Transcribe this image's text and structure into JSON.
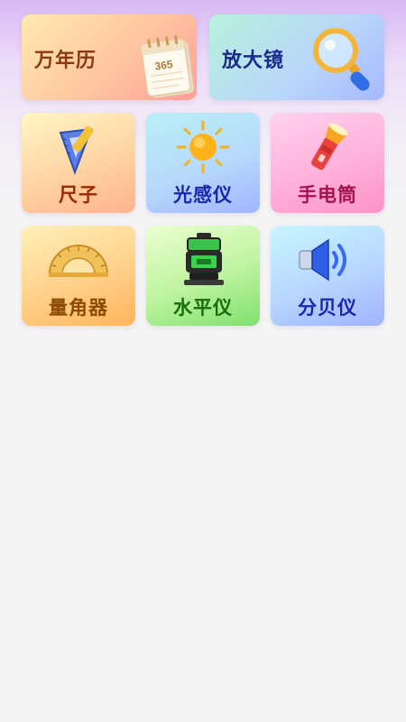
{
  "tools": {
    "calendar": {
      "label": "万年历",
      "icon": "calendar-icon",
      "calendar_number": "365"
    },
    "magnifier": {
      "label": "放大镜",
      "icon": "magnifier-icon"
    },
    "ruler": {
      "label": "尺子",
      "icon": "ruler-icon"
    },
    "light_sensor": {
      "label": "光感仪",
      "icon": "sun-icon"
    },
    "flashlight": {
      "label": "手电筒",
      "icon": "flashlight-icon"
    },
    "protractor": {
      "label": "量角器",
      "icon": "protractor-icon"
    },
    "level": {
      "label": "水平仪",
      "icon": "laser-level-icon"
    },
    "decibel_meter": {
      "label": "分贝仪",
      "icon": "speaker-icon"
    }
  },
  "colors": {
    "background": "#f5f5f5",
    "header_tint": "#d7b9f5"
  }
}
